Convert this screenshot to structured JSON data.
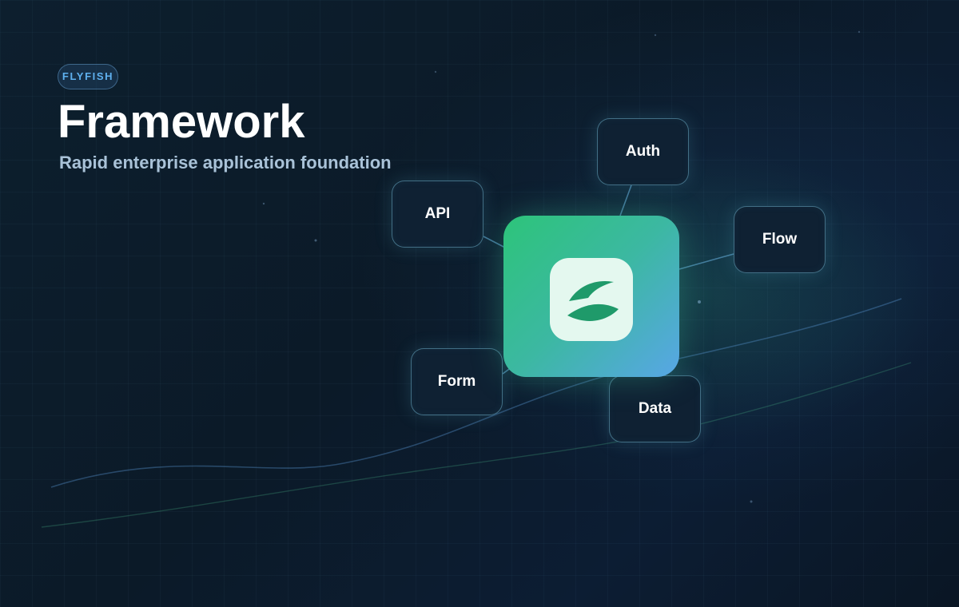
{
  "brand": {
    "label": "FLYFISH"
  },
  "header": {
    "title": "Framework",
    "subtitle": "Rapid enterprise application foundation"
  },
  "diagram": {
    "hub": {
      "icon": "flyfish-logo-icon"
    },
    "modules": [
      {
        "id": "auth",
        "label": "Auth"
      },
      {
        "id": "api",
        "label": "API"
      },
      {
        "id": "flow",
        "label": "Flow"
      },
      {
        "id": "form",
        "label": "Form"
      },
      {
        "id": "data",
        "label": "Data"
      }
    ]
  },
  "colors": {
    "accent": "#5fb0ee",
    "hub_gradient_start": "#2dc47a",
    "hub_gradient_end": "#58a6e6",
    "logo_green": "#1f9a6a",
    "logo_bg": "#e4f8ef",
    "node_bg": "#0f2133",
    "background": "#0b1825"
  }
}
